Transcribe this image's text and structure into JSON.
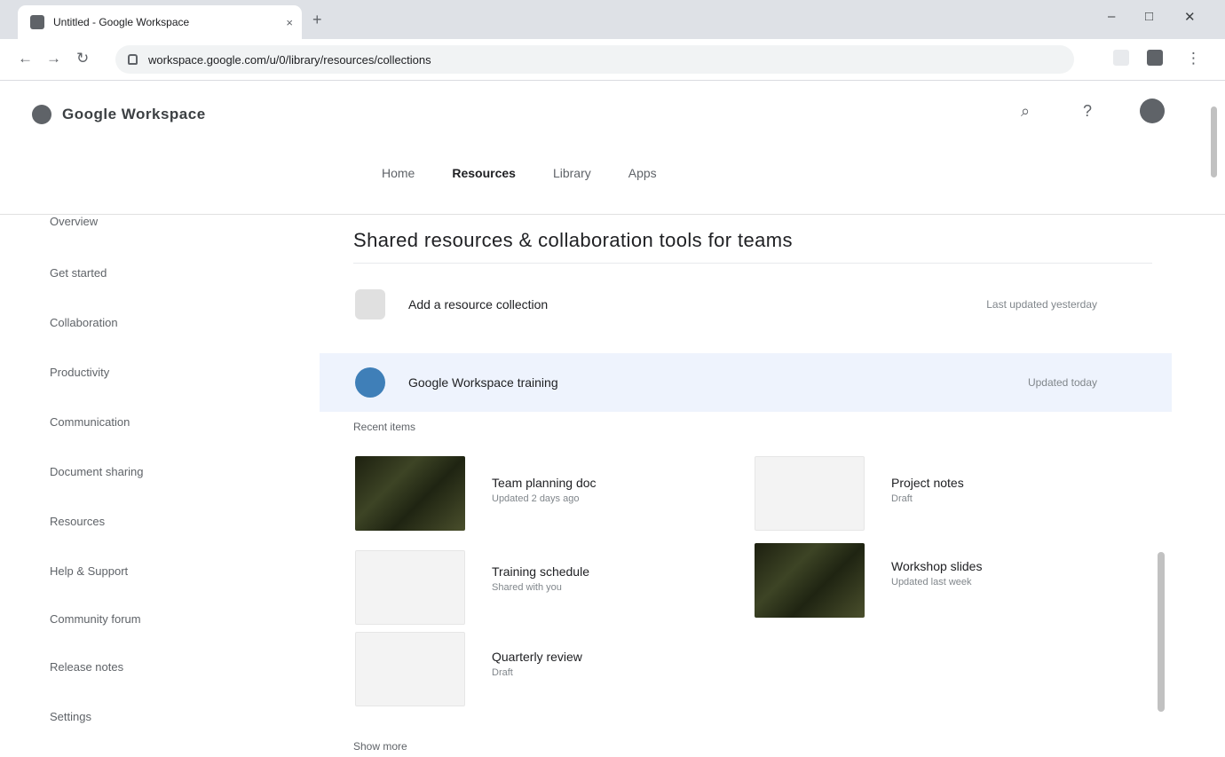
{
  "browser": {
    "tab_title": "Untitled - Google Workspace",
    "close_glyph": "×",
    "new_tab_glyph": "+",
    "address": "workspace.google.com/u/0/library/resources/collections",
    "min_glyph": "–",
    "max_glyph": "□",
    "close_window_glyph": "✕"
  },
  "site": {
    "brand": "Google Workspace",
    "tabs": [
      {
        "label": "Home"
      },
      {
        "label": "Resources"
      },
      {
        "label": "Library"
      },
      {
        "label": "Apps"
      }
    ]
  },
  "sidebar": {
    "items": [
      {
        "label": "Overview"
      },
      {
        "label": "Get started"
      },
      {
        "label": "Collaboration"
      },
      {
        "label": "Productivity"
      },
      {
        "label": "Communication"
      },
      {
        "label": "Document sharing"
      },
      {
        "label": "Resources"
      },
      {
        "label": "Help & Support"
      },
      {
        "label": "Community forum"
      },
      {
        "label": "Release notes"
      },
      {
        "label": "Settings"
      }
    ]
  },
  "main": {
    "title": "Shared resources & collaboration tools for teams",
    "rows": [
      {
        "label": "Add a resource collection",
        "meta": "Last updated yesterday"
      },
      {
        "label": "Google Workspace training",
        "meta": "Updated today"
      }
    ],
    "section_label": "Recent items",
    "cards": [
      {
        "title": "Team planning doc",
        "sub": "Updated 2 days ago"
      },
      {
        "title": "Project notes",
        "sub": "Draft"
      },
      {
        "title": "Training schedule",
        "sub": "Shared with you"
      },
      {
        "title": "Workshop slides",
        "sub": "Updated last week"
      },
      {
        "title": "Quarterly review",
        "sub": "Draft"
      }
    ],
    "footer_label": "Show more"
  },
  "colors": {
    "accent": "#1a73e8",
    "selected_row": "#eef3fd"
  },
  "icons": [
    "back-icon",
    "forward-icon",
    "reload-icon",
    "lock-icon",
    "search-icon",
    "help-icon",
    "apps-icon"
  ]
}
